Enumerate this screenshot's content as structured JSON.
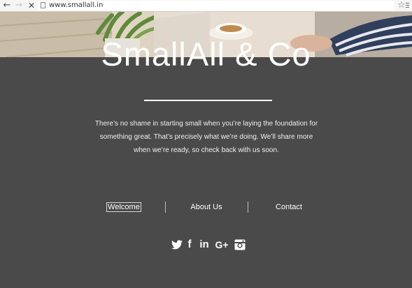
{
  "browser": {
    "url": "www.smallall.in",
    "back": "←",
    "forward": "→",
    "stop": "✕",
    "star": "☆"
  },
  "hero": {
    "title": "SmallAll & Co",
    "tagline": "There’s no shame in starting small when you’re laying the foundation for something great. That’s precisely what we’re doing. We’ll share more when we’re ready, so check back with us soon."
  },
  "nav": {
    "items": [
      {
        "label": "Welcome",
        "active": true
      },
      {
        "label": "About Us",
        "active": false
      },
      {
        "label": "Contact",
        "active": false
      }
    ]
  },
  "social": {
    "icons": [
      "twitter-icon",
      "facebook-icon",
      "linkedin-icon",
      "google-plus-icon",
      "instagram-icon"
    ],
    "facebook_glyph": "f",
    "linkedin_glyph": "in",
    "google_glyph": "G+"
  },
  "colors": {
    "background": "#4a4a4a",
    "text": "#ffffff"
  }
}
